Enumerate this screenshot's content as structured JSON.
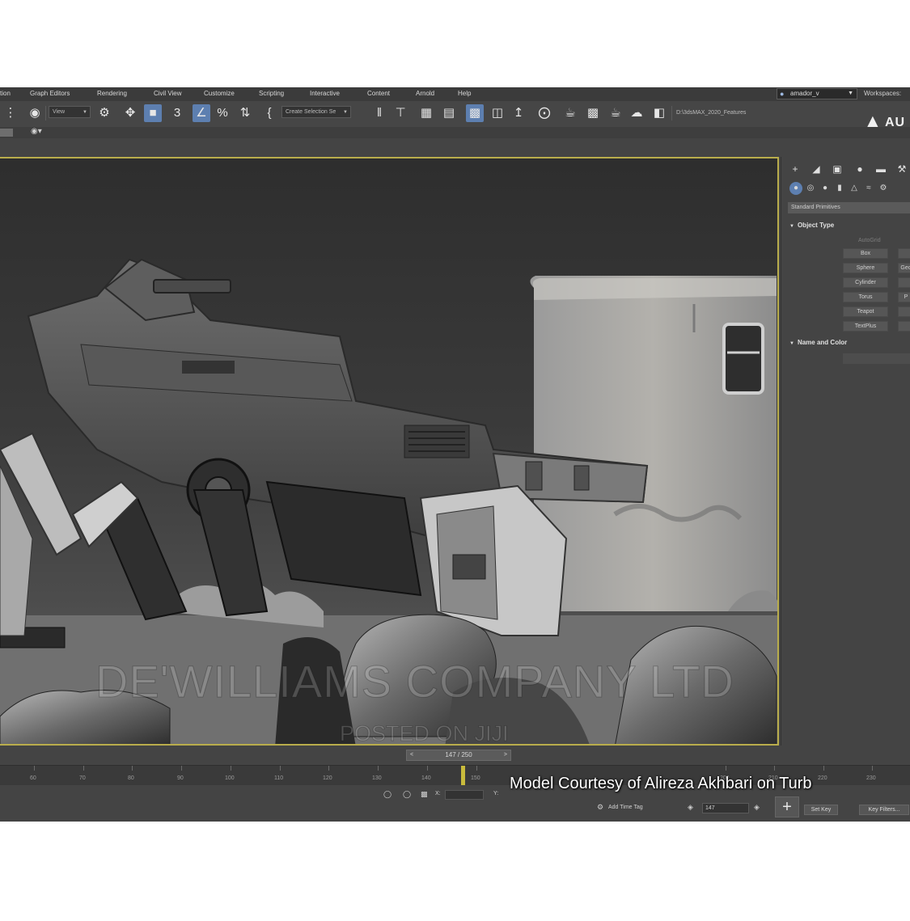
{
  "menu": {
    "items": [
      "tion",
      "Graph Editors",
      "Rendering",
      "Civil View",
      "Customize",
      "Scripting",
      "Interactive",
      "Content",
      "Arnold",
      "Help"
    ],
    "user": "amador_v",
    "workspaces_label": "Workspaces:"
  },
  "toolbar": {
    "view_dropdown": "View",
    "selection_set": "Create Selection Se",
    "project_path": "D:\\3dsMAX_2020_Features",
    "logo_text": "AU"
  },
  "command_panel": {
    "category": "Standard Primitives",
    "object_type_title": "Object Type",
    "autogrid": "AutoGrid",
    "buttons_col1": [
      "Box",
      "Sphere",
      "Cylinder",
      "Torus",
      "Teapot",
      "TextPlus"
    ],
    "buttons_col2": [
      "",
      "Geo",
      "",
      "P",
      "",
      ""
    ],
    "name_color_title": "Name and Color"
  },
  "timeline": {
    "frame_display": "147 / 250",
    "ruler_labels": [
      "60",
      "70",
      "80",
      "90",
      "100",
      "110",
      "120",
      "130",
      "140",
      "150",
      "200",
      "210",
      "220",
      "230"
    ],
    "current_frame": "147",
    "x_label": "X:",
    "y_label": "Y:",
    "add_time_tag": "Add Time Tag",
    "set_key": "Set Key",
    "key_filters": "Key Filters..."
  },
  "overlay": {
    "credit": "Model Courtesy of Alireza Akhbari on Turb"
  },
  "watermark": {
    "company": "DE'WILLIAMS COMPANY LTD",
    "posted": "POSTED ON JIJI"
  },
  "colors": {
    "ui_background": "#444444",
    "viewport_border": "#b9ad4c",
    "active_button": "#5d7fb0",
    "playhead": "#c9bb3c"
  }
}
